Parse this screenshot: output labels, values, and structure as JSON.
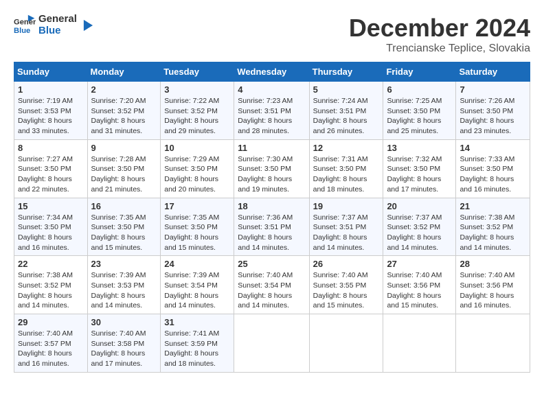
{
  "logo": {
    "text_general": "General",
    "text_blue": "Blue"
  },
  "title": "December 2024",
  "subtitle": "Trencianske Teplice, Slovakia",
  "days_of_week": [
    "Sunday",
    "Monday",
    "Tuesday",
    "Wednesday",
    "Thursday",
    "Friday",
    "Saturday"
  ],
  "weeks": [
    [
      {
        "day": "1",
        "sunrise": "7:19 AM",
        "sunset": "3:53 PM",
        "daylight": "8 hours and 33 minutes."
      },
      {
        "day": "2",
        "sunrise": "7:20 AM",
        "sunset": "3:52 PM",
        "daylight": "8 hours and 31 minutes."
      },
      {
        "day": "3",
        "sunrise": "7:22 AM",
        "sunset": "3:52 PM",
        "daylight": "8 hours and 29 minutes."
      },
      {
        "day": "4",
        "sunrise": "7:23 AM",
        "sunset": "3:51 PM",
        "daylight": "8 hours and 28 minutes."
      },
      {
        "day": "5",
        "sunrise": "7:24 AM",
        "sunset": "3:51 PM",
        "daylight": "8 hours and 26 minutes."
      },
      {
        "day": "6",
        "sunrise": "7:25 AM",
        "sunset": "3:50 PM",
        "daylight": "8 hours and 25 minutes."
      },
      {
        "day": "7",
        "sunrise": "7:26 AM",
        "sunset": "3:50 PM",
        "daylight": "8 hours and 23 minutes."
      }
    ],
    [
      {
        "day": "8",
        "sunrise": "7:27 AM",
        "sunset": "3:50 PM",
        "daylight": "8 hours and 22 minutes."
      },
      {
        "day": "9",
        "sunrise": "7:28 AM",
        "sunset": "3:50 PM",
        "daylight": "8 hours and 21 minutes."
      },
      {
        "day": "10",
        "sunrise": "7:29 AM",
        "sunset": "3:50 PM",
        "daylight": "8 hours and 20 minutes."
      },
      {
        "day": "11",
        "sunrise": "7:30 AM",
        "sunset": "3:50 PM",
        "daylight": "8 hours and 19 minutes."
      },
      {
        "day": "12",
        "sunrise": "7:31 AM",
        "sunset": "3:50 PM",
        "daylight": "8 hours and 18 minutes."
      },
      {
        "day": "13",
        "sunrise": "7:32 AM",
        "sunset": "3:50 PM",
        "daylight": "8 hours and 17 minutes."
      },
      {
        "day": "14",
        "sunrise": "7:33 AM",
        "sunset": "3:50 PM",
        "daylight": "8 hours and 16 minutes."
      }
    ],
    [
      {
        "day": "15",
        "sunrise": "7:34 AM",
        "sunset": "3:50 PM",
        "daylight": "8 hours and 16 minutes."
      },
      {
        "day": "16",
        "sunrise": "7:35 AM",
        "sunset": "3:50 PM",
        "daylight": "8 hours and 15 minutes."
      },
      {
        "day": "17",
        "sunrise": "7:35 AM",
        "sunset": "3:50 PM",
        "daylight": "8 hours and 15 minutes."
      },
      {
        "day": "18",
        "sunrise": "7:36 AM",
        "sunset": "3:51 PM",
        "daylight": "8 hours and 14 minutes."
      },
      {
        "day": "19",
        "sunrise": "7:37 AM",
        "sunset": "3:51 PM",
        "daylight": "8 hours and 14 minutes."
      },
      {
        "day": "20",
        "sunrise": "7:37 AM",
        "sunset": "3:52 PM",
        "daylight": "8 hours and 14 minutes."
      },
      {
        "day": "21",
        "sunrise": "7:38 AM",
        "sunset": "3:52 PM",
        "daylight": "8 hours and 14 minutes."
      }
    ],
    [
      {
        "day": "22",
        "sunrise": "7:38 AM",
        "sunset": "3:52 PM",
        "daylight": "8 hours and 14 minutes."
      },
      {
        "day": "23",
        "sunrise": "7:39 AM",
        "sunset": "3:53 PM",
        "daylight": "8 hours and 14 minutes."
      },
      {
        "day": "24",
        "sunrise": "7:39 AM",
        "sunset": "3:54 PM",
        "daylight": "8 hours and 14 minutes."
      },
      {
        "day": "25",
        "sunrise": "7:40 AM",
        "sunset": "3:54 PM",
        "daylight": "8 hours and 14 minutes."
      },
      {
        "day": "26",
        "sunrise": "7:40 AM",
        "sunset": "3:55 PM",
        "daylight": "8 hours and 15 minutes."
      },
      {
        "day": "27",
        "sunrise": "7:40 AM",
        "sunset": "3:56 PM",
        "daylight": "8 hours and 15 minutes."
      },
      {
        "day": "28",
        "sunrise": "7:40 AM",
        "sunset": "3:56 PM",
        "daylight": "8 hours and 16 minutes."
      }
    ],
    [
      {
        "day": "29",
        "sunrise": "7:40 AM",
        "sunset": "3:57 PM",
        "daylight": "8 hours and 16 minutes."
      },
      {
        "day": "30",
        "sunrise": "7:40 AM",
        "sunset": "3:58 PM",
        "daylight": "8 hours and 17 minutes."
      },
      {
        "day": "31",
        "sunrise": "7:41 AM",
        "sunset": "3:59 PM",
        "daylight": "8 hours and 18 minutes."
      },
      null,
      null,
      null,
      null
    ]
  ],
  "labels": {
    "sunrise": "Sunrise:",
    "sunset": "Sunset:",
    "daylight": "Daylight:"
  }
}
